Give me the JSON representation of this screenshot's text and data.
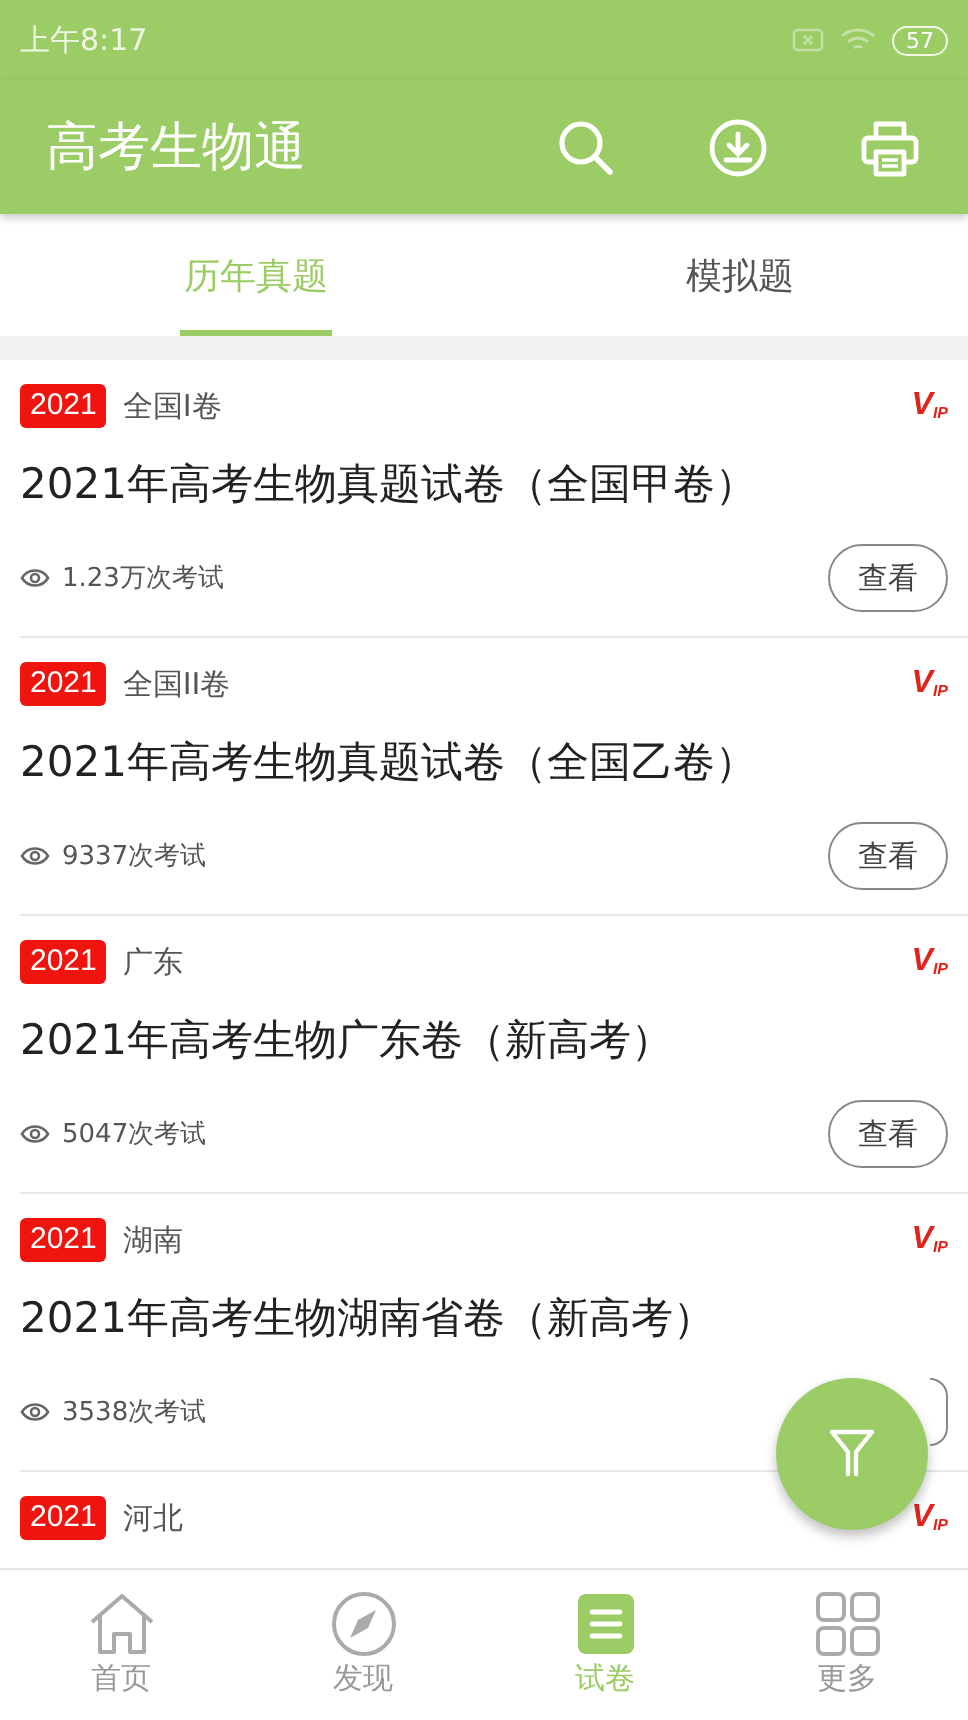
{
  "status_bar": {
    "time": "上午8:17",
    "battery": "57"
  },
  "header": {
    "title": "高考生物通"
  },
  "tabs": [
    {
      "label": "历年真题",
      "selected": true
    },
    {
      "label": "模拟题",
      "selected": false
    }
  ],
  "papers": [
    {
      "year": "2021",
      "region": "全国I卷",
      "vip": {
        "big": "V",
        "small": "IP"
      },
      "title": "2021年高考生物真题试卷（全国甲卷）",
      "count": "1.23万次考试",
      "button": "查看"
    },
    {
      "year": "2021",
      "region": "全国II卷",
      "vip": {
        "big": "V",
        "small": "IP"
      },
      "title": "2021年高考生物真题试卷（全国乙卷）",
      "count": "9337次考试",
      "button": "查看"
    },
    {
      "year": "2021",
      "region": "广东",
      "vip": {
        "big": "V",
        "small": "IP"
      },
      "title": "2021年高考生物广东卷（新高考）",
      "count": "5047次考试",
      "button": "查看"
    },
    {
      "year": "2021",
      "region": "湖南",
      "vip": {
        "big": "V",
        "small": "IP"
      },
      "title": "2021年高考生物湖南省卷（新高考）",
      "count": "3538次考试"
    },
    {
      "year": "2021",
      "region": "河北",
      "vip": {
        "big": "V",
        "small": "IP"
      }
    }
  ],
  "nav": [
    {
      "label": "首页",
      "kind": "home",
      "selected": false
    },
    {
      "label": "发现",
      "kind": "compass",
      "selected": false
    },
    {
      "label": "试卷",
      "kind": "paper",
      "selected": true
    },
    {
      "label": "更多",
      "kind": "grid",
      "selected": false
    }
  ]
}
